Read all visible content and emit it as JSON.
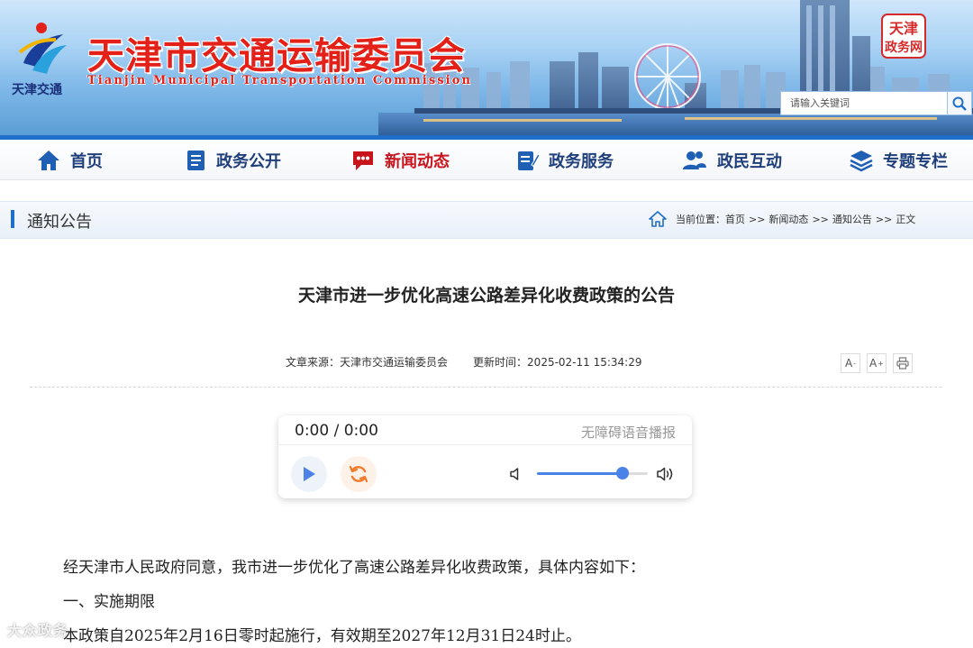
{
  "header": {
    "logo_caption": "天津交通",
    "site_title": "天津市交通运输委员会",
    "site_subtitle": "Tianjin Municipal Transportation Commission",
    "seal_text": "天津政务网",
    "search": {
      "placeholder": "请输入关键词"
    }
  },
  "nav": {
    "items": [
      {
        "label": "首页",
        "icon": "home-icon"
      },
      {
        "label": "政务公开",
        "icon": "document-icon"
      },
      {
        "label": "新闻动态",
        "icon": "chat-bubble-icon",
        "active": true
      },
      {
        "label": "政务服务",
        "icon": "edit-form-icon"
      },
      {
        "label": "政民互动",
        "icon": "users-icon"
      },
      {
        "label": "专题专栏",
        "icon": "layers-icon"
      }
    ]
  },
  "section": {
    "title": "通知公告",
    "breadcrumb": {
      "prefix": "当前位置：",
      "items": [
        "首页",
        "新闻动态",
        "通知公告",
        "正文"
      ],
      "separator": ">>"
    }
  },
  "article": {
    "title": "天津市进一步优化高速公路差异化收费政策的公告",
    "source_label": "文章来源：",
    "source": "天津市交通运输委员会",
    "updated_label": "更新时间：",
    "updated": "2025-02-11 15:34:29",
    "tools": {
      "font_smaller": "A",
      "font_larger": "A",
      "minus": "-",
      "plus": "+"
    },
    "paragraphs": [
      "经天津市人民政府同意，我市进一步优化了高速公路差异化收费政策，具体内容如下：",
      "一、实施期限",
      "本政策自2025年2月16日零时起施行，有效期至2027年12月31日24时止。"
    ]
  },
  "player": {
    "time": "0:00 / 0:00",
    "caption": "无障碍语音播报",
    "volume": 0.77
  },
  "watermark": "大众政务",
  "colors": {
    "brand_red": "#e32119",
    "nav_blue": "#1f3f7a",
    "accent_blue": "#1f6ec7",
    "player_blue": "#4a82e8"
  }
}
